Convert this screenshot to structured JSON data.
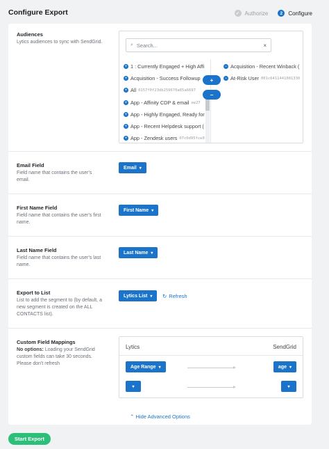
{
  "header": {
    "title": "Configure Export",
    "steps": [
      {
        "label": "Authorize",
        "icon": "check-icon",
        "state": "done"
      },
      {
        "label": "Configure",
        "number": "2",
        "state": "active"
      }
    ]
  },
  "audiences": {
    "label": "Audiences",
    "description": "Lytics audiences to sync with SendGrid.",
    "search_placeholder": "Search...",
    "available": [
      {
        "name": "1 : Currently Engaged + High Affi",
        "id": ""
      },
      {
        "name": "Acquisition - Success Followup",
        "id": ""
      },
      {
        "name": "All",
        "id": "0157f0f23db259670a65a6697"
      },
      {
        "name": "App - Affinity CDP & email",
        "id": "ee27"
      },
      {
        "name": "App - Highly Engaged, Ready for",
        "id": ""
      },
      {
        "name": "App - Recent Helpdesk support (",
        "id": ""
      },
      {
        "name": "App - Zendesk users",
        "id": "07c0d95fce0"
      }
    ],
    "selected": [
      {
        "name": "Acquisition - Recent Winback (",
        "id": ""
      },
      {
        "name": "At-Risk User",
        "id": "001c6411441001330"
      }
    ]
  },
  "email_field": {
    "label": "Email Field",
    "description": "Field name that contains the user's email.",
    "value": "Email"
  },
  "first_name_field": {
    "label": "First Name Field",
    "description": "Field name that contains the user's first name.",
    "value": "First Name"
  },
  "last_name_field": {
    "label": "Last Name Field",
    "description": "Field name that contains the user's last name.",
    "value": "Last Name"
  },
  "export_list": {
    "label": "Export to List",
    "description": "List to add the segment to (by default, a new segment is created on the ALL CONTACTS list).",
    "value": "Lytics List",
    "refresh_label": "Refresh"
  },
  "custom_fields": {
    "label": "Custom Field Mappings",
    "note_bold": "No options:",
    "note": " Loading your SendGrid custom fields can take 30 seconds. Please don't refresh",
    "left_header": "Lytics",
    "right_header": "SendGrid",
    "rows": [
      {
        "left": "Age Range",
        "right": "age"
      },
      {
        "left": "",
        "right": ""
      }
    ]
  },
  "advanced_toggle": "Hide Advanced Options",
  "start_button": "Start Export",
  "colors": {
    "accent": "#1b74c9",
    "start": "#2cbf7a"
  }
}
